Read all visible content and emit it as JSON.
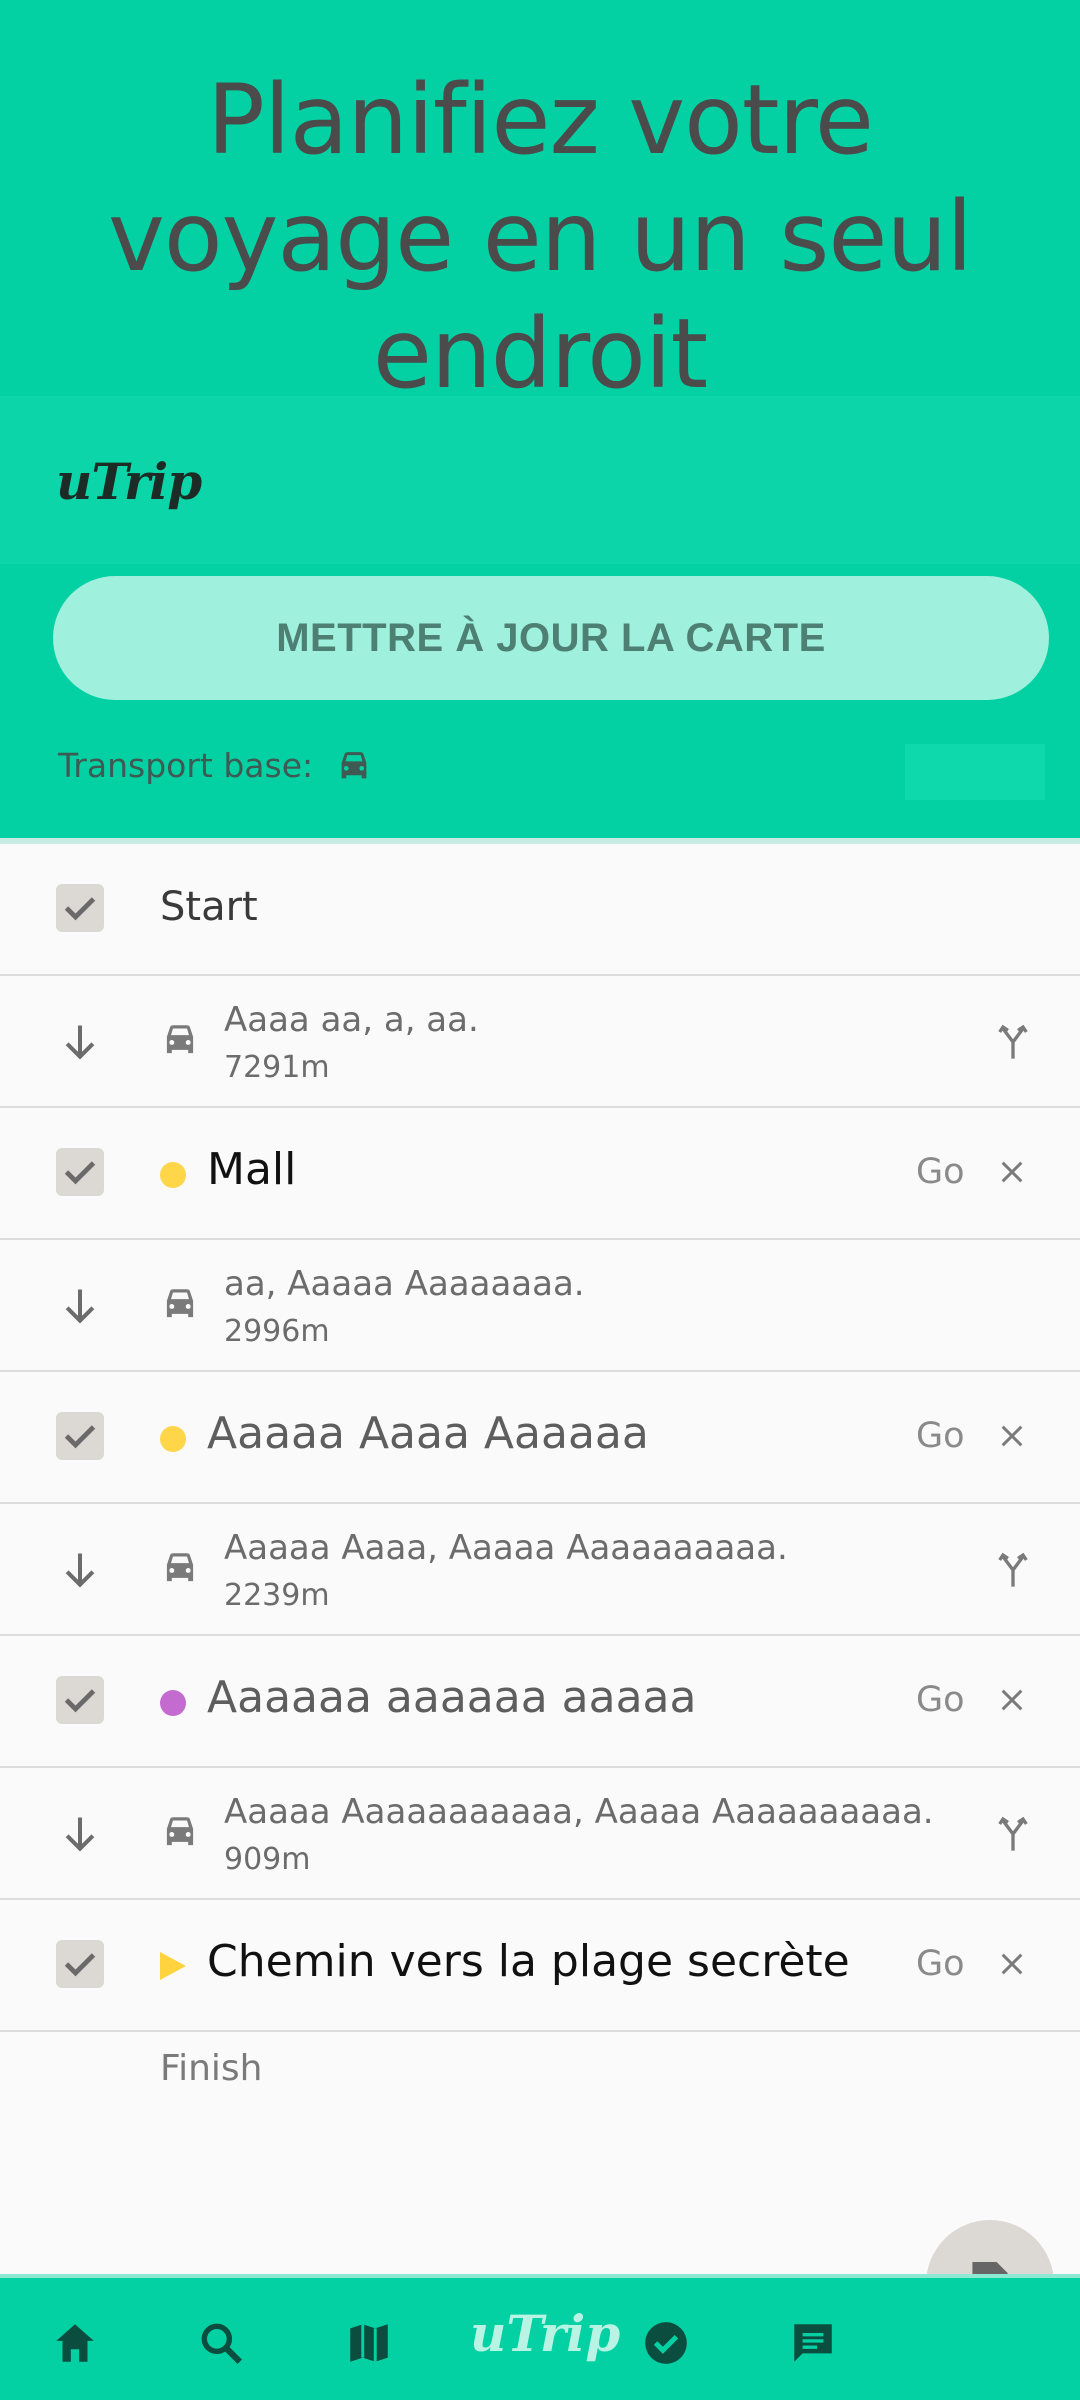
{
  "header": {
    "title": "Planifiez votre voyage en un seul endroit",
    "logo": "uTrip",
    "update_button": "METTRE À JOUR LA CARTE",
    "transport_label": "Transport base:",
    "transport_icon": "car-icon"
  },
  "itinerary": {
    "start_label": "Start",
    "finish_label": "Finish",
    "go_label": "Go",
    "segments": [
      {
        "title": "Aaaa aa, a, aa.",
        "distance": "7291m"
      },
      {
        "title": "aa, Aaaaa Aaaaaaaa.",
        "distance": "2996m"
      },
      {
        "title": "Aaaaa Aaaa, Aaaaa Aaaaaaaaaa.",
        "distance": "2239m"
      },
      {
        "title": "Aaaaa Aaaaaaaaaaa, Aaaaa Aaaaaaaaaa.",
        "distance": "909m"
      }
    ],
    "stops": [
      {
        "name": "Mall",
        "marker_color": "#ffd54a"
      },
      {
        "name": "Aaaaa Aaaa Aaaaaa",
        "marker_color": "#ffd54a"
      },
      {
        "name": "Aaaaaa aaaaaa aaaaa",
        "marker_color": "#c46bd0"
      },
      {
        "name": "Chemin vers la plage secrète",
        "marker_color": "#ffd33d"
      }
    ]
  },
  "bottom_nav": {
    "items": [
      "home-icon",
      "search-icon",
      "map-icon",
      "logo",
      "check-circle-icon",
      "chat-icon"
    ],
    "logo": "uTrip"
  },
  "colors": {
    "primary": "#03d1a4",
    "button": "#9ff0dc"
  }
}
